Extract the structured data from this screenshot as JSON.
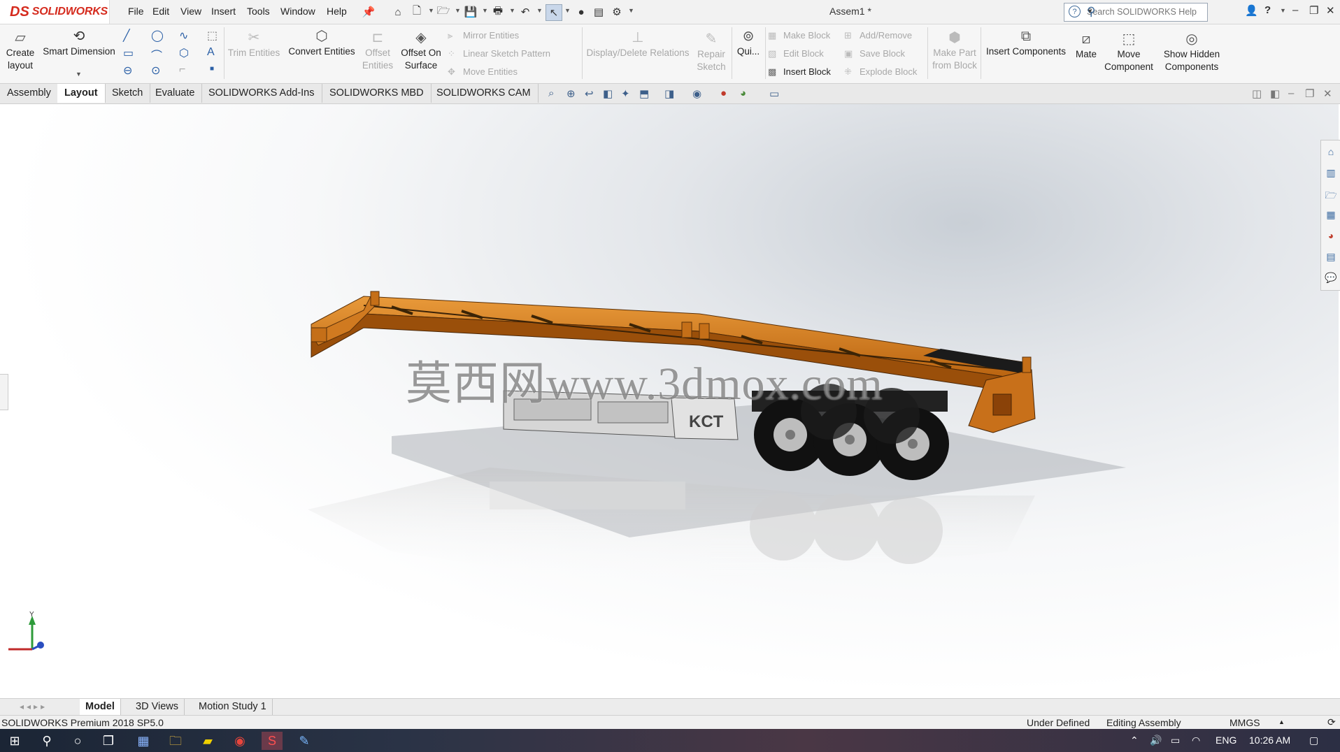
{
  "app": {
    "brand_ds": "DS",
    "brand_name": "SOLIDWORKS",
    "document_title": "Assem1 *"
  },
  "menu": [
    "File",
    "Edit",
    "View",
    "Insert",
    "Tools",
    "Window",
    "Help"
  ],
  "search": {
    "placeholder": "Search SOLIDWORKS Help"
  },
  "command_manager": {
    "create_layout": "Create layout",
    "smart_dimension": "Smart Dimension",
    "trim_entities": "Trim Entities",
    "convert_entities": "Convert Entities",
    "offset_entities": "Offset Entities",
    "offset_on_surface": "Offset On Surface",
    "mirror_entities": "Mirror Entities",
    "linear_sketch_pattern": "Linear Sketch Pattern",
    "move_entities": "Move Entities",
    "display_delete_relations": "Display/Delete Relations",
    "repair_sketch": "Repair Sketch",
    "quick_snaps": "Qui...",
    "make_block": "Make Block",
    "edit_block": "Edit Block",
    "insert_block": "Insert Block",
    "add_remove": "Add/Remove",
    "save_block": "Save Block",
    "explode_block": "Explode Block",
    "make_part_from_block": "Make Part from Block",
    "insert_components": "Insert Components",
    "mate": "Mate",
    "move_component": "Move Component",
    "show_hidden_components": "Show Hidden Components"
  },
  "tabs": [
    "Assembly",
    "Layout",
    "Sketch",
    "Evaluate",
    "SOLIDWORKS Add-Ins",
    "SOLIDWORKS MBD",
    "SOLIDWORKS CAM"
  ],
  "active_tab": "Layout",
  "model": {
    "plate_text": "KCT",
    "watermark": "莫西网www.3dmox.com",
    "axis_y": "Y"
  },
  "bottom_tabs": [
    "Model",
    "3D Views",
    "Motion Study 1"
  ],
  "status": {
    "product": "SOLIDWORKS Premium 2018 SP5.0",
    "state": "Under Defined",
    "mode": "Editing Assembly",
    "units": "MMGS"
  },
  "taskbar": {
    "lang": "ENG",
    "time": "10:26 AM"
  },
  "colors": {
    "trailer": "#d9791a",
    "accent": "#d52b1e"
  }
}
